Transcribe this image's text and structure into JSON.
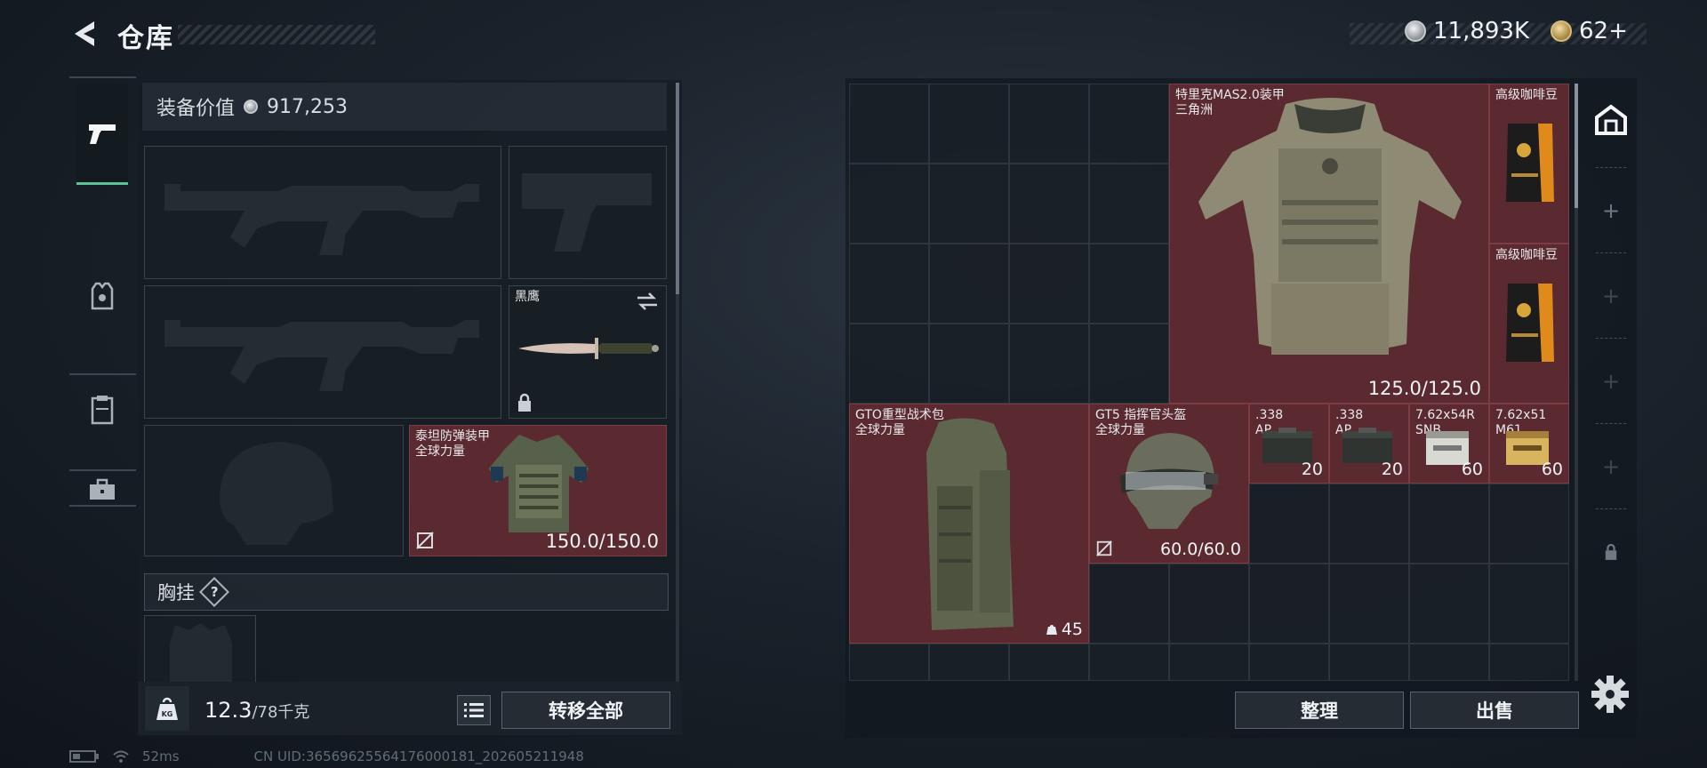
{
  "header": {
    "title": "仓库"
  },
  "currency": {
    "silver": "11,893K",
    "gold": "62+"
  },
  "equipment": {
    "value_label": "装备价值",
    "value": "917,253",
    "melee": {
      "name": "黑鹰"
    },
    "armor": {
      "name": "泰坦防弹装甲",
      "sub": "全球力量",
      "durability": "150.0/150.0"
    },
    "chest_rig_label": "胸挂",
    "help_mark": "?"
  },
  "weight": {
    "current": "12.3",
    "max": "/78千克"
  },
  "actions": {
    "transfer_all": "转移全部",
    "organize": "整理",
    "sell": "出售"
  },
  "warehouse_items": [
    {
      "name": "特里克MAS2.0装甲",
      "sub": "三角洲",
      "durability": "125.0/125.0"
    },
    {
      "name": "高级咖啡豆",
      "sub": ""
    },
    {
      "name": "高级咖啡豆",
      "sub": ""
    },
    {
      "name": "GTO重型战术包",
      "sub": "全球力量",
      "count": "45"
    },
    {
      "name": "GT5 指挥官头盔",
      "sub": "全球力量",
      "durability": "60.0/60.0"
    },
    {
      "name": ".338",
      "sub": "AP",
      "count": "20"
    },
    {
      "name": ".338",
      "sub": "AP",
      "count": "20"
    },
    {
      "name": "7.62x54R",
      "sub": "SNB",
      "count": "60"
    },
    {
      "name": "7.62x51",
      "sub": "M61",
      "count": "60"
    }
  ],
  "status": {
    "ping": "52ms",
    "uid": "CN UID:36569625564176000181_202605211948"
  },
  "colors": {
    "accent": "#59c49a",
    "item_bg": "#5b2a31",
    "panel_bg": "#1a222b"
  }
}
